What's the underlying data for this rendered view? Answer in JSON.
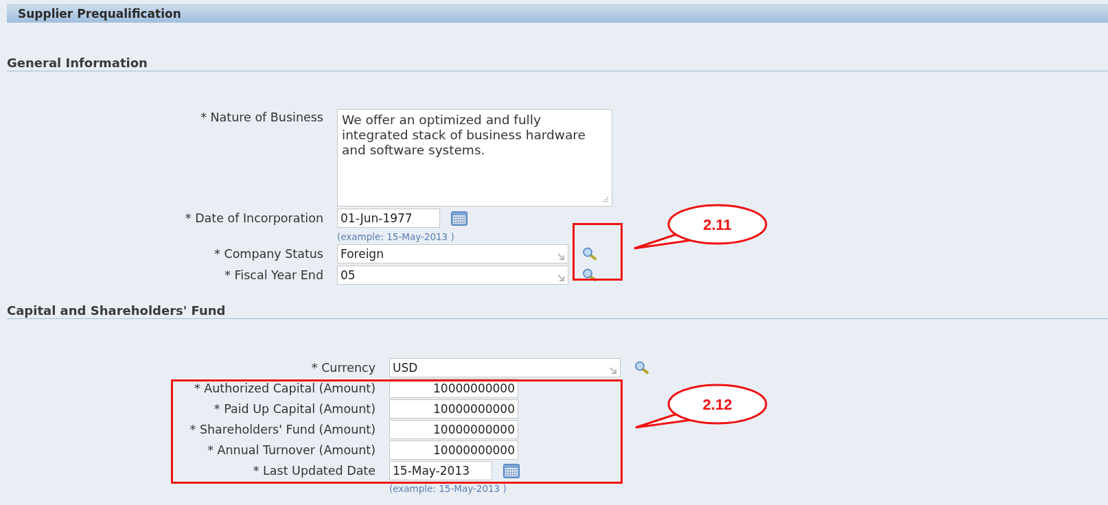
{
  "title_bar": {
    "title": "Supplier Prequalification"
  },
  "sections": [
    {
      "heading": "General Information",
      "fields": [
        {
          "kind": "textarea",
          "label": "* Nature of Business",
          "value": "We offer an optimized and fully integrated stack of business hardware and software systems."
        },
        {
          "kind": "date",
          "label": "* Date of Incorporation",
          "value": "01-Jun-1977",
          "hint": "(example: 15-May-2013 )"
        },
        {
          "kind": "lov",
          "label": "* Company Status",
          "value": "Foreign"
        },
        {
          "kind": "lov",
          "label": "* Fiscal Year End",
          "value": "05"
        }
      ]
    },
    {
      "heading": "Capital and Shareholders' Fund",
      "fields": [
        {
          "kind": "lov",
          "label": "* Currency",
          "value": "USD"
        },
        {
          "kind": "amount",
          "label": "* Authorized Capital (Amount)",
          "value": "10000000000"
        },
        {
          "kind": "amount",
          "label": "* Paid Up Capital (Amount)",
          "value": "10000000000"
        },
        {
          "kind": "amount",
          "label": "* Shareholders' Fund (Amount)",
          "value": "10000000000"
        },
        {
          "kind": "amount",
          "label": "* Annual Turnover (Amount)",
          "value": "10000000000"
        },
        {
          "kind": "date",
          "label": "* Last Updated Date",
          "value": "15-May-2013",
          "hint": "(example: 15-May-2013 )"
        }
      ]
    }
  ],
  "callouts": [
    {
      "label": "2.11"
    },
    {
      "label": "2.12"
    }
  ]
}
